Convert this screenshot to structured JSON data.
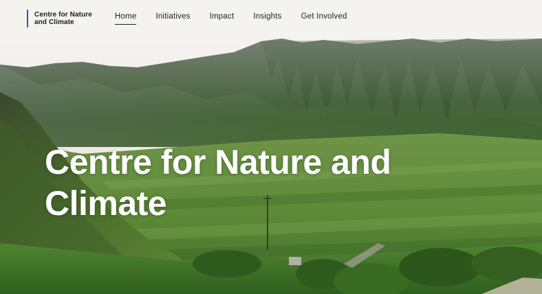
{
  "header": {
    "logo_text": "Centre for Nature and Climate",
    "nav": [
      {
        "label": "Home",
        "active": true
      },
      {
        "label": "Initiatives",
        "active": false
      },
      {
        "label": "Impact",
        "active": false
      },
      {
        "label": "Insights",
        "active": false
      },
      {
        "label": "Get Involved",
        "active": false
      }
    ]
  },
  "hero": {
    "title": "Centre for Nature and Climate",
    "image_subject": "green mountain valley landscape"
  },
  "colors": {
    "logo_bar": "#2a5d9a",
    "header_bg": "#f5f3ef",
    "title": "#ffffff"
  }
}
